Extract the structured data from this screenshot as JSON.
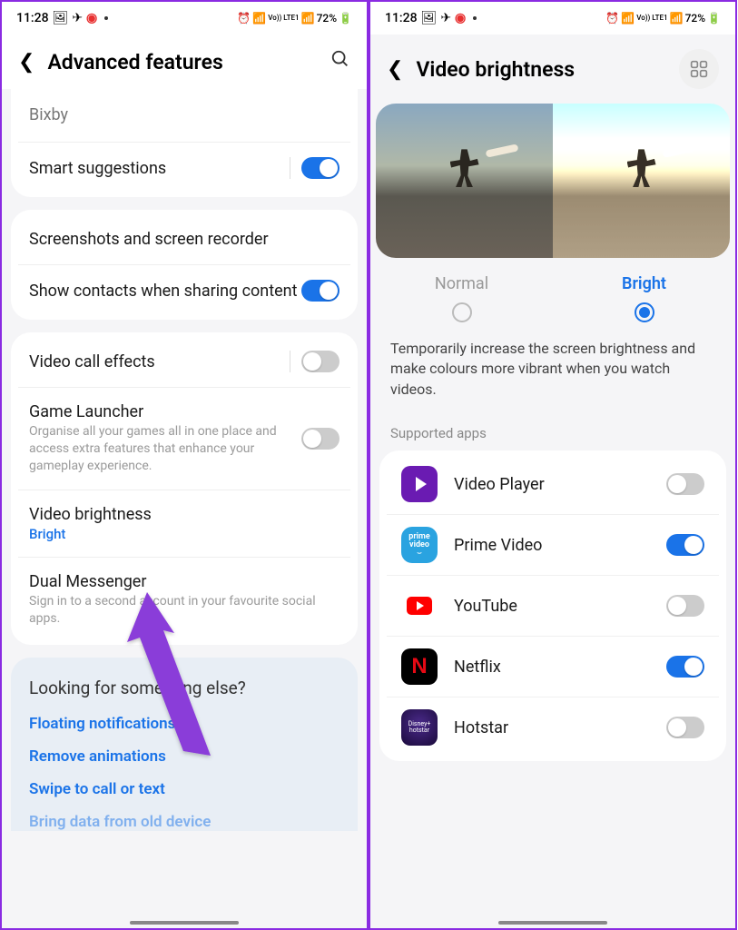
{
  "status": {
    "time": "11:28",
    "battery": "72%",
    "signal_label": "Vo)) LTE1"
  },
  "left": {
    "title": "Advanced features",
    "items": {
      "bixby": "Bixby",
      "smart_suggestions": "Smart suggestions",
      "screenshots": "Screenshots and screen recorder",
      "show_contacts": "Show contacts when sharing content",
      "video_call": "Video call effects",
      "game_launcher": {
        "title": "Game Launcher",
        "sub": "Organise all your games all in one place and access extra features that enhance your gameplay experience."
      },
      "video_brightness": {
        "title": "Video brightness",
        "value": "Bright"
      },
      "dual_messenger": {
        "title": "Dual Messenger",
        "sub": "Sign in to a second account in your favourite social apps."
      }
    },
    "footer": {
      "title": "Looking for something else?",
      "links": [
        "Floating notifications",
        "Remove animations",
        "Swipe to call or text",
        "Bring data from old device"
      ]
    }
  },
  "right": {
    "title": "Video brightness",
    "options": {
      "normal": "Normal",
      "bright": "Bright"
    },
    "selected": "bright",
    "description": "Temporarily increase the screen brightness and make colours more vibrant when you watch videos.",
    "supported_label": "Supported apps",
    "apps": [
      {
        "name": "Video Player",
        "on": false,
        "icon": "play"
      },
      {
        "name": "Prime Video",
        "on": true,
        "icon": "prime"
      },
      {
        "name": "YouTube",
        "on": false,
        "icon": "yt"
      },
      {
        "name": "Netflix",
        "on": true,
        "icon": "netflix"
      },
      {
        "name": "Hotstar",
        "on": false,
        "icon": "hotstar"
      }
    ]
  }
}
